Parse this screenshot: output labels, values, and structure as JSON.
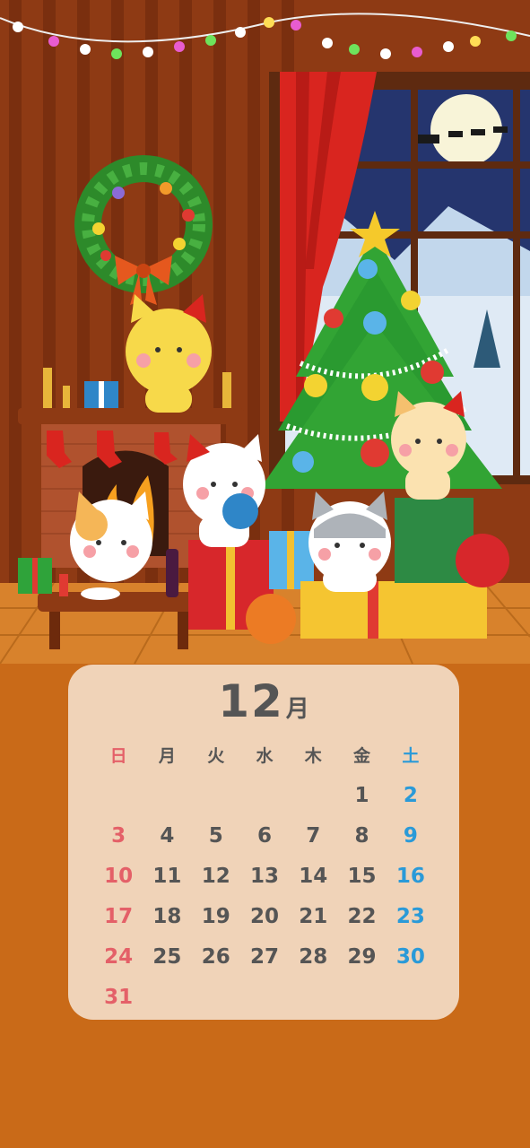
{
  "calendar": {
    "month_number": "12",
    "month_unit": "月",
    "weekdays": [
      "日",
      "月",
      "火",
      "水",
      "木",
      "金",
      "土"
    ],
    "weeks": [
      [
        "",
        "",
        "",
        "",
        "",
        "1",
        "2"
      ],
      [
        "3",
        "4",
        "5",
        "6",
        "7",
        "8",
        "9"
      ],
      [
        "10",
        "11",
        "12",
        "13",
        "14",
        "15",
        "16"
      ],
      [
        "17",
        "18",
        "19",
        "20",
        "21",
        "22",
        "23"
      ],
      [
        "24",
        "25",
        "26",
        "27",
        "28",
        "29",
        "30"
      ],
      [
        "31",
        "",
        "",
        "",
        "",
        "",
        ""
      ]
    ]
  },
  "colors": {
    "background": "#c96a18",
    "card": "#f0d3b8",
    "sunday": "#e46068",
    "saturday": "#2a9ad8",
    "text": "#555555"
  }
}
